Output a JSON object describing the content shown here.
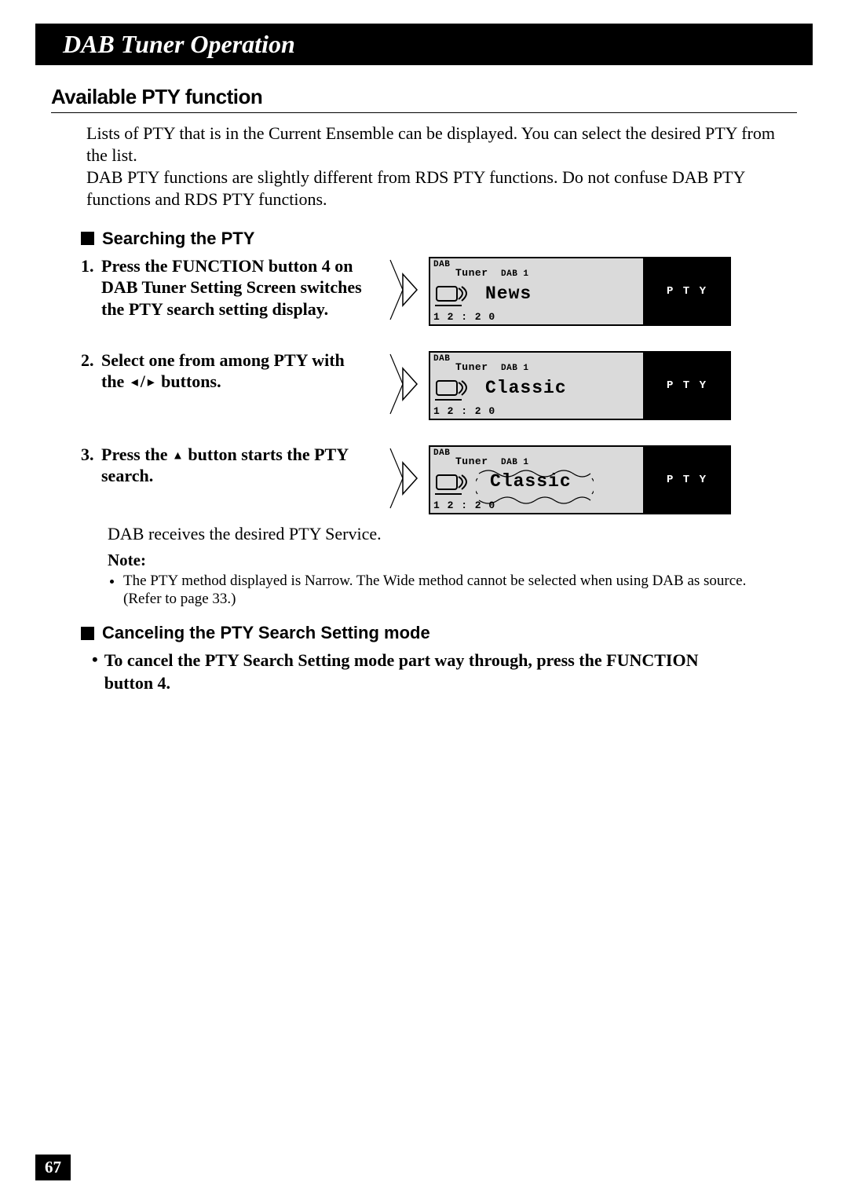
{
  "page": {
    "header": "DAB Tuner Operation",
    "section_title": "Available PTY function",
    "intro_p1": "Lists of PTY that is in the Current Ensemble can be displayed. You can select the desired PTY from the list.",
    "intro_p2": "DAB PTY functions are slightly different from RDS PTY functions. Do not confuse DAB PTY functions and RDS PTY functions.",
    "subhead_search": "Searching the PTY",
    "step1_num": "1.",
    "step1_text": "Press the FUNCTION button 4 on DAB Tuner Setting Screen switches the PTY search setting display.",
    "step2_num": "2.",
    "step2_text_a": "Select one from among PTY with the ",
    "step2_text_b": " buttons.",
    "step3_num": "3.",
    "step3_text_a": "Press the ",
    "step3_text_b": " button starts the PTY search.",
    "after_step3": "DAB receives the desired PTY Service.",
    "note_label": "Note:",
    "note_bullet": "The PTY method displayed is Narrow. The Wide method cannot be selected when using DAB as source. (Refer to page 33.)",
    "subhead_cancel": "Canceling the PTY Search Setting mode",
    "cancel_text": "To cancel the PTY Search Setting mode part way through, press the FUNCTION button 4.",
    "page_number": "67"
  },
  "lcd": {
    "dab": "DAB",
    "tuner": "Tuner",
    "dab1": "DAB 1",
    "time": "1 2 : 2 0",
    "pty": "P T Y",
    "screen1_text": "News",
    "screen2_text": "Classic",
    "screen3_text": "Classic"
  }
}
